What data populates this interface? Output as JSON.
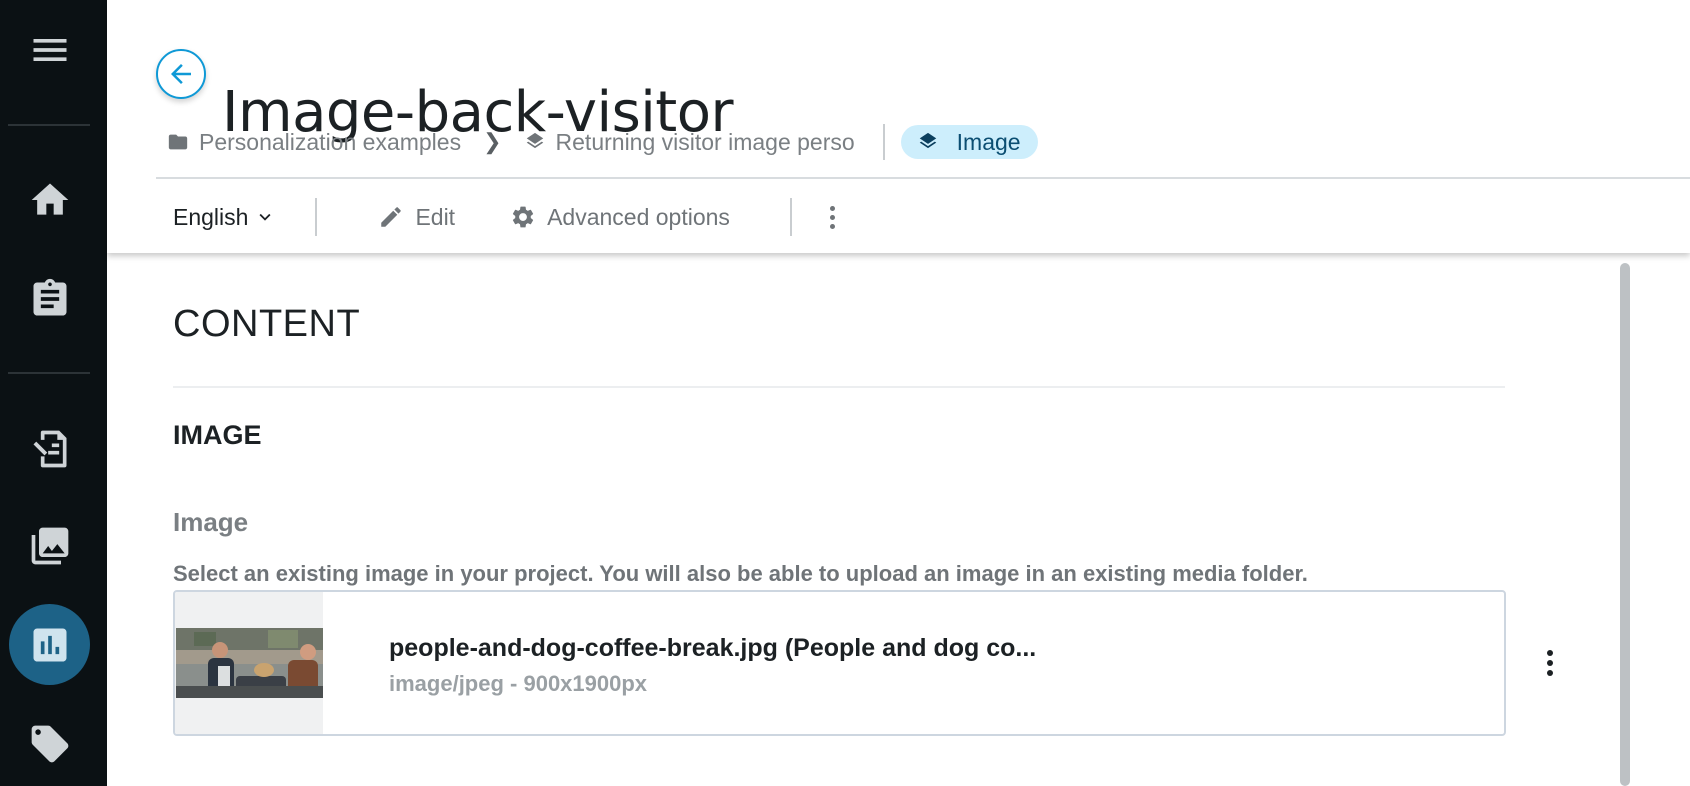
{
  "sidebar": {
    "items": [
      {
        "icon": "menu-icon"
      },
      {
        "icon": "home-icon"
      },
      {
        "icon": "clipboard-icon"
      },
      {
        "icon": "document-edit-icon"
      },
      {
        "icon": "images-icon"
      },
      {
        "icon": "analytics-icon",
        "active": true
      },
      {
        "icon": "tag-icon"
      }
    ]
  },
  "header": {
    "title": "Image-back-visitor",
    "breadcrumb": {
      "folder": "Personalization examples",
      "parent": "Returning visitor image perso",
      "current": "Image"
    },
    "toolbar": {
      "language": "English",
      "edit_label": "Edit",
      "advanced_label": "Advanced options"
    }
  },
  "content": {
    "section_title": "CONTENT",
    "subsection_title": "IMAGE",
    "field": {
      "label": "Image",
      "help": "Select an existing image in your project. You will also be able to upload an image in an existing media folder."
    },
    "media": {
      "file_name": "people-and-dog-coffee-break.jpg (People and dog co...",
      "meta": "image/jpeg - 900x1900px"
    }
  },
  "colors": {
    "sidebar_bg": "#0b1114",
    "sidebar_active": "#1d6287",
    "accent": "#0f99d6",
    "chip_bg": "#cdeefc"
  }
}
